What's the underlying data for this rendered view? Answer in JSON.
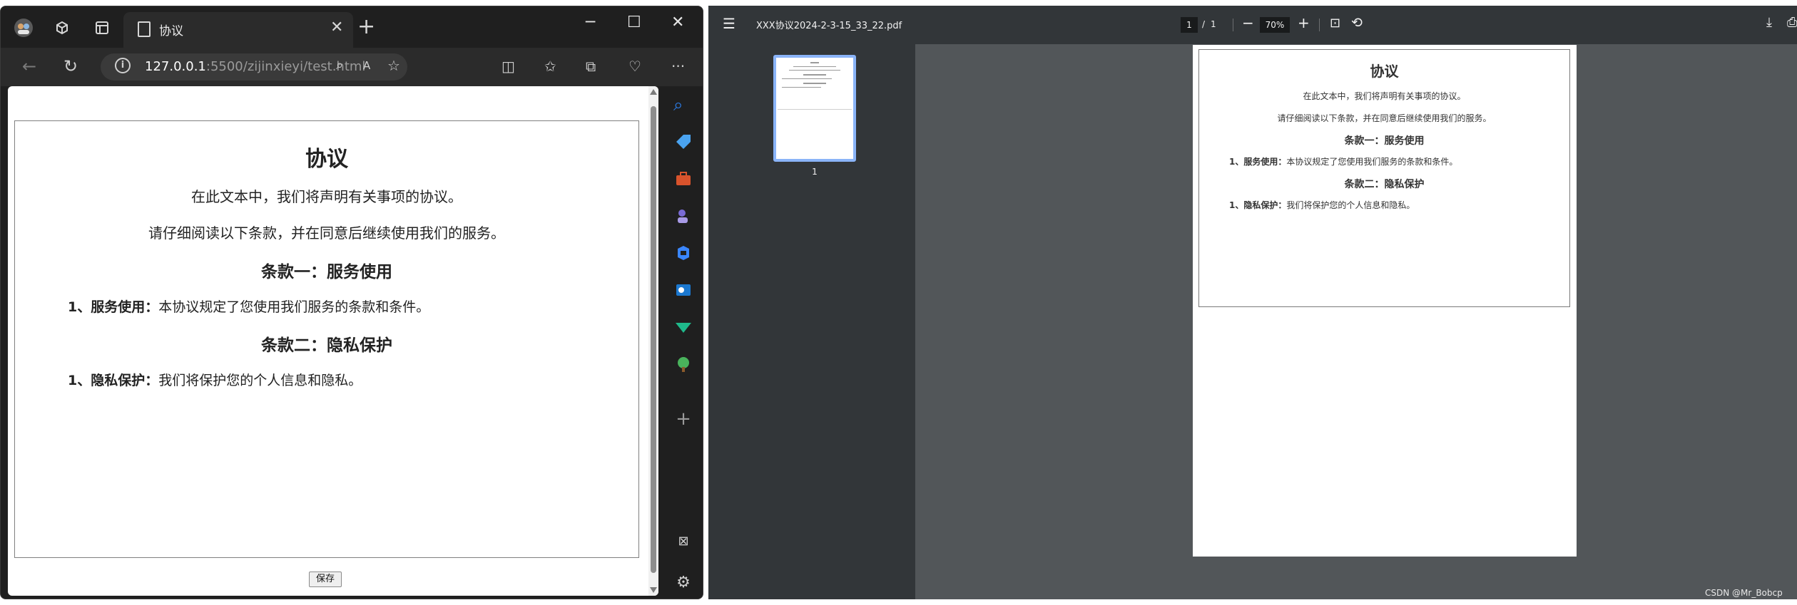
{
  "browser": {
    "tab": {
      "title": "协议",
      "icon": "page-icon"
    },
    "new_tab_icon": "plus-icon",
    "window_controls": [
      "minimize-icon",
      "maximize-icon",
      "close-icon"
    ],
    "address": {
      "host": "127.0.0.1",
      "rest": ":5500/zijinxieyi/test.html"
    },
    "doc": {
      "title": "协议",
      "intro1": "在此文本中，我们将声明有关事项的协议。",
      "intro2": "请仔细阅读以下条款，并在同意后继续使用我们的服务。",
      "clause1": {
        "heading": "条款一：服务使用",
        "item_label": "1、服务使用：",
        "item_text": "本协议规定了您使用我们服务的条款和条件。"
      },
      "clause2": {
        "heading": "条款二：隐私保护",
        "item_label": "1、隐私保护：",
        "item_text": "我们将保护您的个人信息和隐私。"
      },
      "save_button": "保存"
    },
    "sidebar_icon_colors": [
      "#2b7de9",
      "#4aa3f0",
      "#d9532c",
      "#7a6bd6",
      "#3a86ff",
      "#1b78d0",
      "#1fb98b",
      "#49b35c"
    ]
  },
  "pdf": {
    "filename": "XXX协议2024-2-3-15_33_22.pdf",
    "page_current": "1",
    "page_separator": "/",
    "page_total": "1",
    "zoom": "70%",
    "thumbnail_page_number": "1",
    "page": {
      "title": "协议",
      "intro1": "在此文本中，我们将声明有关事项的协议。",
      "intro2": "请仔细阅读以下条款，并在同意后继续使用我们的服务。",
      "clause1_heading": "条款一：服务使用",
      "clause1_label": "1、服务使用：",
      "clause1_text": "本协议规定了您使用我们服务的条款和条件。",
      "clause2_heading": "条款二：隐私保护",
      "clause2_label": "1、隐私保护：",
      "clause2_text": "我们将保护您的个人信息和隐私。"
    }
  },
  "watermark": "CSDN @Mr_Bobcp"
}
